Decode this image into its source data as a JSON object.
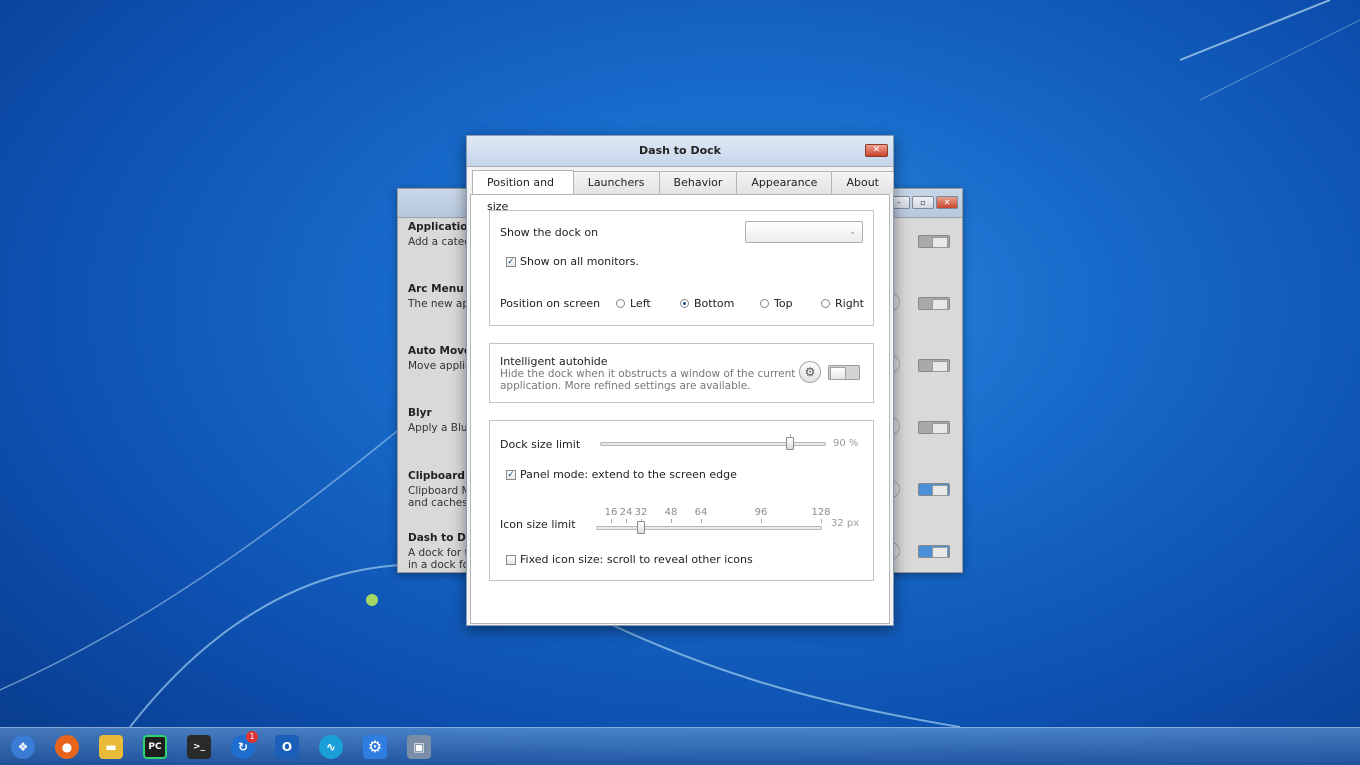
{
  "dialog": {
    "title": "Dash to Dock",
    "close_label": "✕",
    "tabs": [
      {
        "label": "Position and size",
        "active": true
      },
      {
        "label": "Launchers",
        "active": false
      },
      {
        "label": "Behavior",
        "active": false
      },
      {
        "label": "Appearance",
        "active": false
      },
      {
        "label": "About",
        "active": false
      }
    ],
    "position": {
      "show_dock_on_label": "Show the dock on",
      "monitor_select_value": "",
      "show_all_monitors": {
        "label": "Show on all monitors.",
        "checked": true
      },
      "position_label": "Position on screen",
      "options": [
        {
          "label": "Left",
          "selected": false
        },
        {
          "label": "Bottom",
          "selected": true
        },
        {
          "label": "Top",
          "selected": false
        },
        {
          "label": "Right",
          "selected": false
        }
      ]
    },
    "autohide": {
      "title": "Intelligent autohide",
      "description_line1": "Hide the dock when it obstructs a window of the current",
      "description_line2": "application. More refined settings are available.",
      "enabled": false
    },
    "size": {
      "dock_size_label": "Dock size limit",
      "dock_size_value": "90 %",
      "dock_size_fraction": 0.9,
      "panel_mode": {
        "label": "Panel mode: extend to the screen edge",
        "checked": true
      },
      "icon_size_label": "Icon size limit",
      "icon_size_value": "32 px",
      "icon_size_marks": [
        "16",
        "24",
        "32",
        "48",
        "64",
        "96",
        "128"
      ],
      "fixed_icon": {
        "label": "Fixed icon size: scroll to reveal other icons",
        "checked": false
      }
    }
  },
  "background_window": {
    "extensions": [
      {
        "name": "Applications Menu",
        "desc": "Add a category-based menu",
        "enabled": false
      },
      {
        "name": "Arc Menu",
        "desc": "The new applications menu",
        "enabled": false
      },
      {
        "name": "Auto Move Windows",
        "desc": "Move applications to specific workspaces",
        "enabled": false
      },
      {
        "name": "Blyr",
        "desc": "Apply a Blur effect",
        "enabled": false
      },
      {
        "name": "Clipboard Indicator",
        "desc": "Clipboard Manager extension",
        "desc2": "and caches clipboard history",
        "enabled": true
      },
      {
        "name": "Dash to Dock",
        "desc": "A dock for the Gnome Shell",
        "desc2": "in a dock for an easier access",
        "enabled": true
      }
    ]
  },
  "taskbar": {
    "icons": [
      {
        "name": "start-orb-icon",
        "color": "#3a7bd5",
        "glyph": "❖"
      },
      {
        "name": "firefox-icon",
        "color": "#e8641b",
        "glyph": "●"
      },
      {
        "name": "file-manager-icon",
        "color": "#e9b938",
        "glyph": "▬"
      },
      {
        "name": "pycharm-icon",
        "color": "#1d1d1d",
        "glyph": "PC"
      },
      {
        "name": "terminal-icon",
        "color": "#2b2b2b",
        "glyph": ">_"
      },
      {
        "name": "updates-icon",
        "color": "#1e6ed0",
        "glyph": "↻",
        "badge": "1"
      },
      {
        "name": "outlook-icon",
        "color": "#1b5fb8",
        "glyph": "O"
      },
      {
        "name": "audio-icon",
        "color": "#1aa0d8",
        "glyph": "∿"
      },
      {
        "name": "settings-icon",
        "color": "#2f7de1",
        "glyph": "⚙"
      },
      {
        "name": "network-icon",
        "color": "#7a8ea8",
        "glyph": "▣"
      }
    ]
  }
}
